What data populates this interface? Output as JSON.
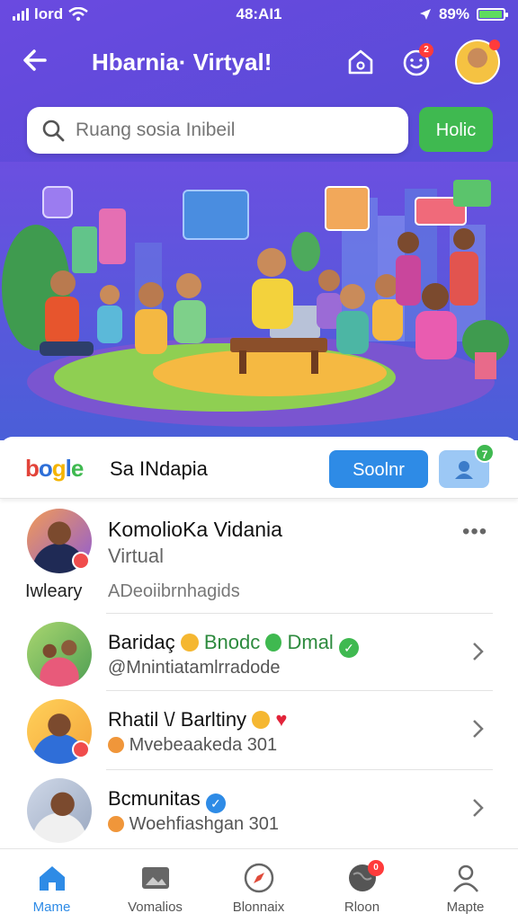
{
  "status_bar": {
    "carrier": "lord",
    "time": "48:AI1",
    "battery": "89%",
    "battery_level": 0.89
  },
  "header": {
    "title": "Hbarnia· Virtyal!",
    "notification_count": "2"
  },
  "search": {
    "placeholder": "Ruang sosia Inibeil",
    "button_label": "Holic"
  },
  "brand": {
    "logo_text": "bogle",
    "name": "Sa INdapia",
    "primary_button": "Soolnr",
    "badge": "7"
  },
  "profile": {
    "name": "KomolioKa Vidania",
    "subtitle": "Virtual",
    "left_label": "Iwleary",
    "description": "ADeoiibrnhagids"
  },
  "list": [
    {
      "title": "Baridaç",
      "tag1": "Bnodc",
      "tag2": "Dmal",
      "subtitle": "@Mnintiatamlrradode"
    },
    {
      "title": "Rhatil \\/ Barltiny",
      "subtitle": "Mvebeaakeda 301"
    },
    {
      "title": "Bcmunitas",
      "subtitle": "Woehfiashgan 301"
    }
  ],
  "tabs": [
    {
      "label": "Mame",
      "icon": "home-icon",
      "active": true
    },
    {
      "label": "Vomalios",
      "icon": "image-icon",
      "active": false
    },
    {
      "label": "Blonnaix",
      "icon": "compass-icon",
      "active": false
    },
    {
      "label": "Rloon",
      "icon": "globe-icon",
      "active": false,
      "badge": "0"
    },
    {
      "label": "Mapte",
      "icon": "person-icon",
      "active": false
    }
  ],
  "colors": {
    "accent": "#2e8be6",
    "header": "#5b4bd8",
    "green": "#3fb950"
  }
}
